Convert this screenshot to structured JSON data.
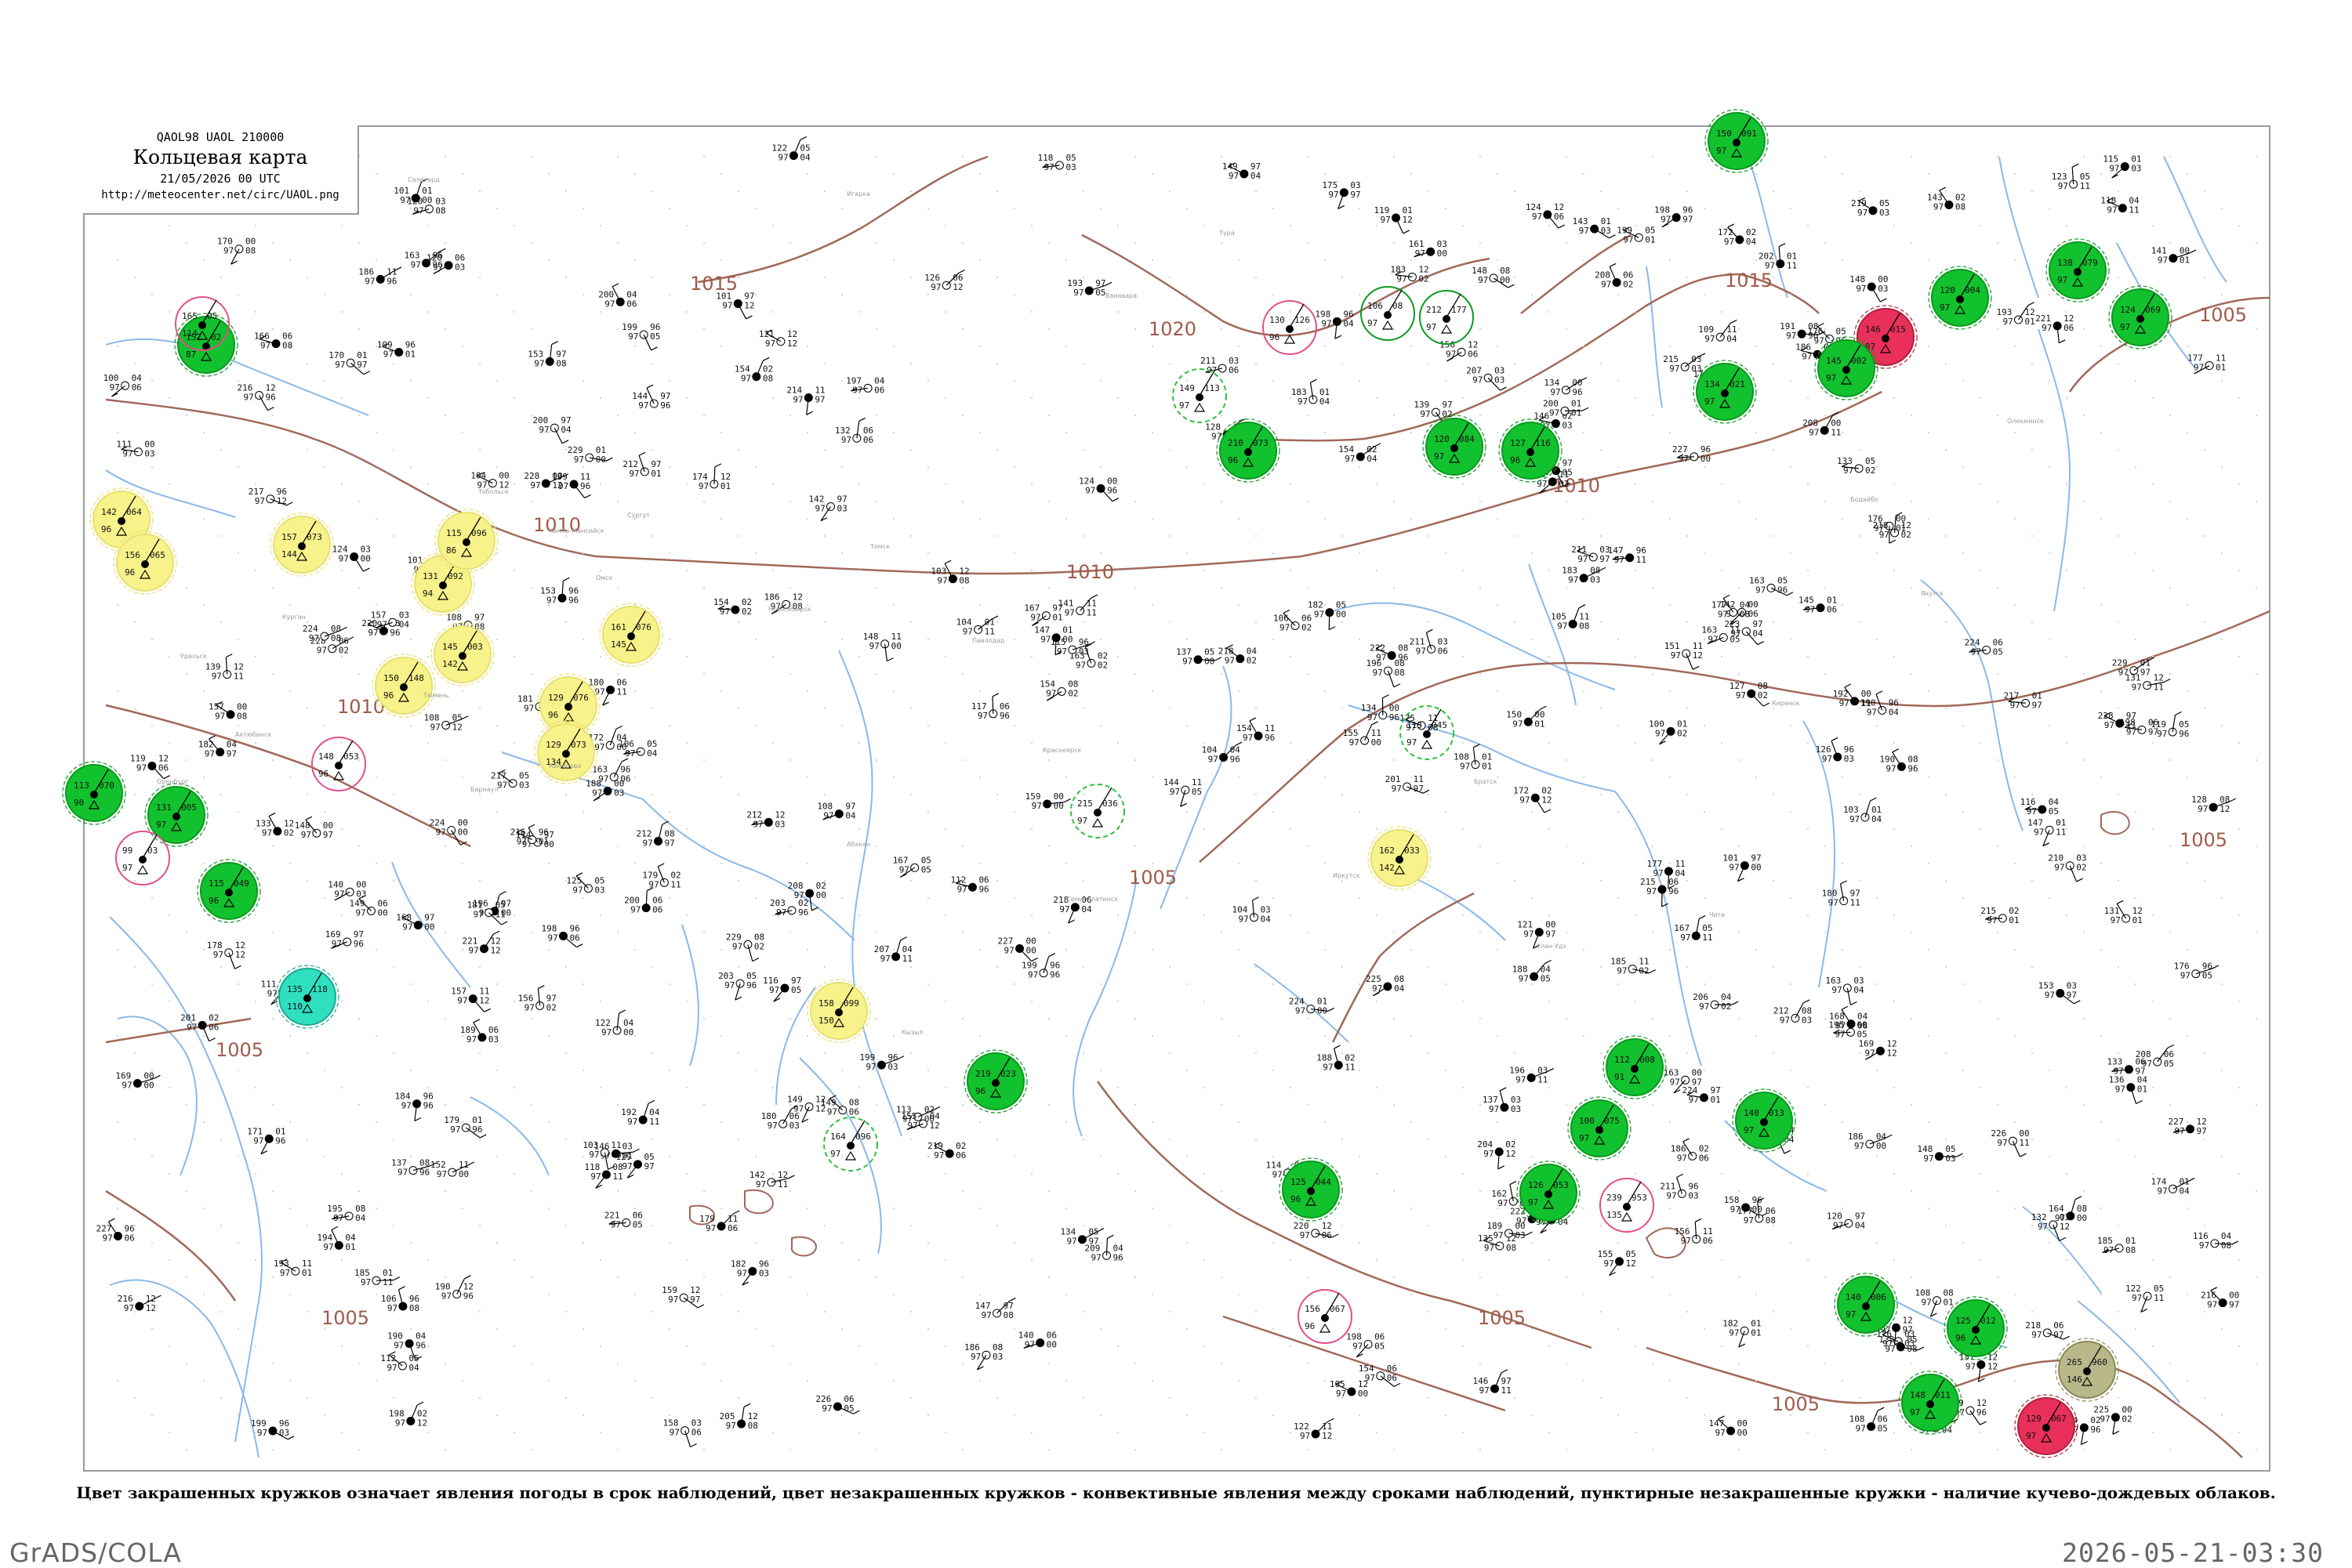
{
  "title_box": {
    "code": "QAOL98  UAOL  210000",
    "title": "Кольцевая карта",
    "date": "21/05/2026 00 UTC",
    "url": "http://meteocenter.net/circ/UAOL.png"
  },
  "caption": "Цвет закрашенных кружков означает явления погоды в срок наблюдений, цвет незакрашенных кружков - конвективные явления между сроками наблюдений, пунктирные незакрашенные кружки - наличие кучево-дождевых облаков.",
  "footer": {
    "left": "GrADS/COLA",
    "right": "2026-05-21-03:30"
  },
  "colors": {
    "isobar": "#a0695a",
    "river": "#8bb8e8",
    "green_fill": "#12c12e",
    "green_ring": "#0a9a1e",
    "yellow_fill": "#f7f28a",
    "red_fill": "#e8305a",
    "cyan_fill": "#2ee0c0",
    "olive_fill": "#b8b88a",
    "magenta_ring": "#e0508a",
    "dashed_green": "#2fbf3f"
  },
  "isobar_labels": [
    {
      "text": "1020"
    },
    {
      "text": "1015"
    },
    {
      "text": "1015"
    },
    {
      "text": "1015"
    },
    {
      "text": "1010"
    },
    {
      "text": "1010"
    },
    {
      "text": "1010"
    },
    {
      "text": "1010"
    },
    {
      "text": "1005"
    },
    {
      "text": "1005"
    },
    {
      "text": "1005"
    },
    {
      "text": "1005"
    },
    {
      "text": "1005"
    },
    {
      "text": "1005"
    },
    {
      "text": "1005"
    }
  ],
  "stations": [
    {
      "t": "152",
      "p": "02",
      "n": "87",
      "s": "filled-green"
    },
    {
      "t": "165",
      "p": "05",
      "n": "114",
      "s": "ring-magenta"
    },
    {
      "t": "142",
      "p": "064",
      "n": "96",
      "s": "filled-yellow"
    },
    {
      "t": "156",
      "p": "065",
      "n": "96",
      "s": "filled-yellow"
    },
    {
      "t": "157",
      "p": "073",
      "n": "144",
      "s": "filled-yellow"
    },
    {
      "t": "131",
      "p": "092",
      "n": "94",
      "s": "filled-yellow"
    },
    {
      "t": "115",
      "p": "096",
      "n": "86",
      "s": "filled-yellow"
    },
    {
      "t": "150",
      "p": "148",
      "n": "96",
      "s": "filled-yellow"
    },
    {
      "t": "145",
      "p": "003",
      "n": "142",
      "s": "filled-yellow"
    },
    {
      "t": "161",
      "p": "076",
      "n": "145",
      "s": "filled-yellow"
    },
    {
      "t": "129",
      "p": "076",
      "n": "96",
      "s": "filled-yellow"
    },
    {
      "t": "129",
      "p": "073",
      "n": "134",
      "s": "filled-yellow"
    },
    {
      "t": "162",
      "p": "033",
      "n": "142",
      "s": "filled-yellow"
    },
    {
      "t": "158",
      "p": "099",
      "n": "150",
      "s": "filled-yellow"
    },
    {
      "t": "113",
      "p": "070",
      "n": "90",
      "s": "filled-green"
    },
    {
      "t": "131",
      "p": "005",
      "n": "97",
      "s": "filled-green"
    },
    {
      "t": "115",
      "p": "049",
      "n": "96",
      "s": "filled-green"
    },
    {
      "t": "135",
      "p": "118",
      "n": "110",
      "s": "filled-cyan"
    },
    {
      "t": "120",
      "p": "084",
      "n": "97",
      "s": "filled-green"
    },
    {
      "t": "127",
      "p": "116",
      "n": "96",
      "s": "filled-green"
    },
    {
      "t": "210",
      "p": "073",
      "n": "96",
      "s": "filled-green"
    },
    {
      "t": "219",
      "p": "023",
      "n": "96",
      "s": "filled-green"
    },
    {
      "t": "125",
      "p": "044",
      "n": "96",
      "s": "filled-green"
    },
    {
      "t": "112",
      "p": "008",
      "n": "91",
      "s": "filled-green"
    },
    {
      "t": "100",
      "p": "075",
      "n": "97",
      "s": "filled-green"
    },
    {
      "t": "126",
      "p": "053",
      "n": "97",
      "s": "filled-green"
    },
    {
      "t": "140",
      "p": "013",
      "n": "97",
      "s": "filled-green"
    },
    {
      "t": "134",
      "p": "021",
      "n": "97",
      "s": "filled-green"
    },
    {
      "t": "146",
      "p": "015",
      "n": "97",
      "s": "filled-red"
    },
    {
      "t": "140",
      "p": "006",
      "n": "97",
      "s": "filled-green"
    },
    {
      "t": "125",
      "p": "012",
      "n": "96",
      "s": "filled-green"
    },
    {
      "t": "265",
      "p": "960",
      "n": "146",
      "s": "filled-olive"
    },
    {
      "t": "148",
      "p": "011",
      "n": "97",
      "s": "filled-green"
    },
    {
      "t": "129",
      "p": "067",
      "n": "97",
      "s": "filled-red"
    },
    {
      "t": "124",
      "p": "069",
      "n": "97",
      "s": "filled-green"
    },
    {
      "t": "138",
      "p": "079",
      "n": "97",
      "s": "filled-green"
    },
    {
      "t": "120",
      "p": "004",
      "n": "97",
      "s": "filled-green"
    },
    {
      "t": "145",
      "p": "002",
      "n": "97",
      "s": "filled-green"
    },
    {
      "t": "150",
      "p": "091",
      "n": "97",
      "s": "filled-green"
    },
    {
      "t": "130",
      "p": "126",
      "n": "96",
      "s": "ring-magenta"
    },
    {
      "t": "212",
      "p": "177",
      "n": "97",
      "s": "ring-green"
    },
    {
      "t": "106",
      "p": "08",
      "n": "97",
      "s": "ring-green"
    },
    {
      "t": "149",
      "p": "113",
      "n": "97",
      "s": "dashed"
    },
    {
      "t": "215",
      "p": "036",
      "n": "97",
      "s": "dashed"
    },
    {
      "t": "164",
      "p": "096",
      "n": "97",
      "s": "dashed"
    },
    {
      "t": "113",
      "p": "045",
      "n": "97",
      "s": "dashed"
    },
    {
      "t": "239",
      "p": "953",
      "n": "135",
      "s": "ring-magenta"
    },
    {
      "t": "99",
      "p": "03",
      "n": "97",
      "s": "ring-magenta"
    },
    {
      "t": "148",
      "p": "053",
      "n": "96",
      "s": "ring-magenta"
    },
    {
      "t": "156",
      "p": "067",
      "n": "96",
      "s": "ring-magenta"
    }
  ],
  "place_names": [
    "Салехард",
    "Игарка",
    "Тура",
    "Ванавара",
    "Ханты-Мансийск",
    "Сургут",
    "Тобольск",
    "Тюмень",
    "Омск",
    "Новосибирск",
    "Томск",
    "Красноярск",
    "Иркутск",
    "Улан-Удэ",
    "Чита",
    "Барнаул",
    "Кемерово",
    "Абакан",
    "Кызыл",
    "Якутск",
    "Олекминск",
    "Бодайбо",
    "Киренск",
    "Братск",
    "Курган",
    "Павлодар",
    "Семипалатинск",
    "Уральск",
    "Оренбург",
    "Актюбинск"
  ],
  "marker_icons": [
    "rain-dot-icon",
    "thunder-icon",
    "shower-icon",
    "fog-icon"
  ]
}
